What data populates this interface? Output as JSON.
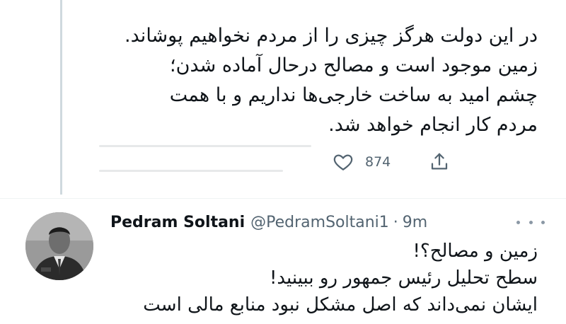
{
  "quoted_tweet": {
    "lines": [
      "در این دولت هرگز چیزی را از مردم نخواهیم پوشاند.",
      "زمین موجود است و مصالح درحال آماده شدن؛",
      "چشم امید به ساخت خارجی‌ها نداریم و با همت",
      "مردم کار انجام خواهد شد."
    ],
    "like_count": "874",
    "like_icon": "heart-outline-icon",
    "share_icon": "share-upload-icon"
  },
  "reply_tweet": {
    "author_name": "Pedram Soltani",
    "author_handle": "@PedramSoltani1",
    "separator": "·",
    "time": "9m",
    "more_icon": "more-dots-icon",
    "lines": [
      "زمین و مصالح؟!",
      "سطح تحلیل رئیس جمهور رو ببینید!",
      "ایشان نمی‌داند که اصل مشکل نبود منابع مالی است"
    ]
  },
  "colors": {
    "text": "#0f1419",
    "muted": "#536471",
    "thread_line": "#cfd9de"
  }
}
